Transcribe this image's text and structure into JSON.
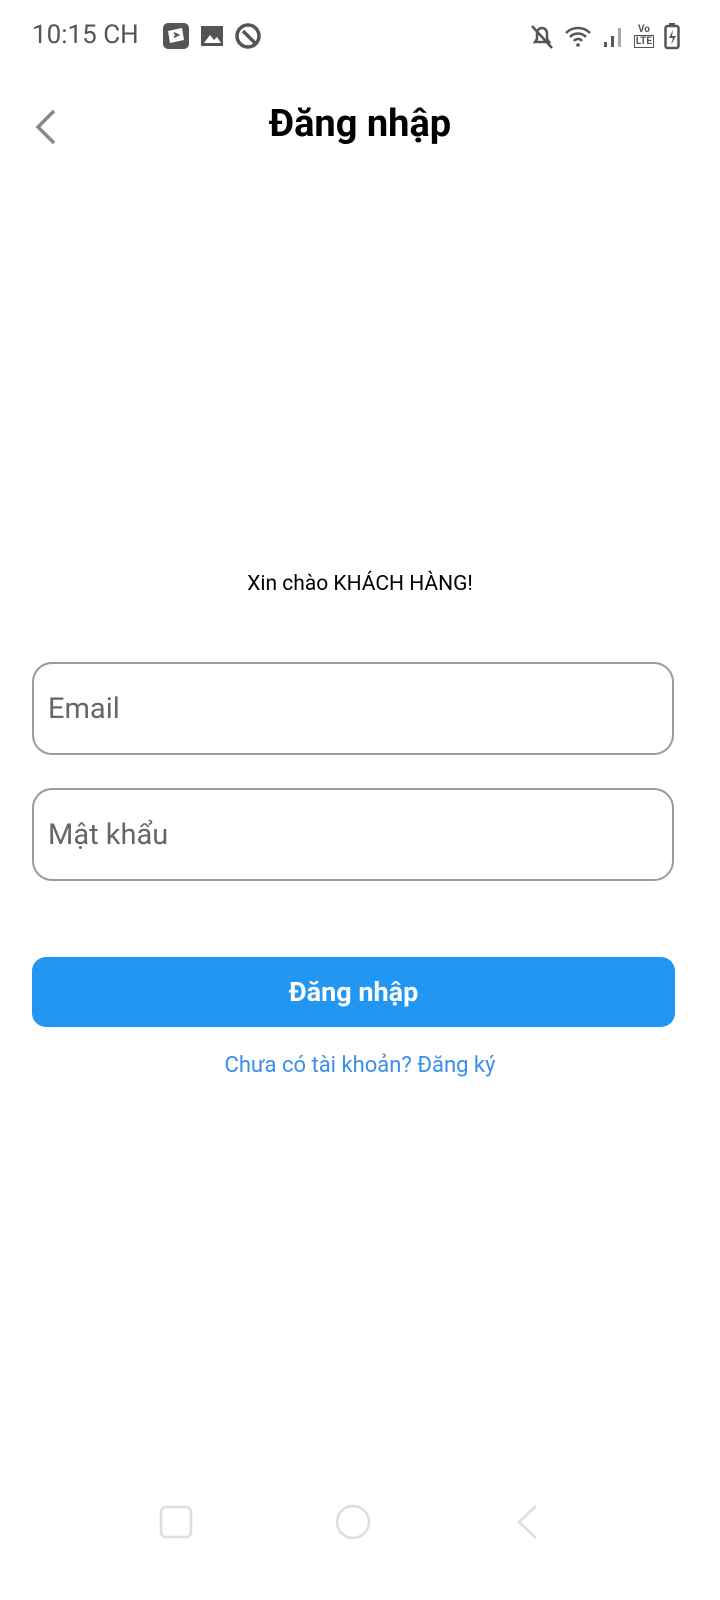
{
  "status_bar": {
    "time": "10:15 CH",
    "left_icons": [
      "video-app-icon",
      "image-icon",
      "app-icon"
    ],
    "right_icons": [
      "bell-off-icon",
      "wifi-icon",
      "signal-icon",
      "volte-icon",
      "battery-charging-icon"
    ],
    "volte_top": "Vo",
    "volte_bottom": "LTE"
  },
  "header": {
    "title": "Đăng nhập",
    "back_icon": "chevron-left-icon"
  },
  "greeting": "Xin chào KHÁCH HÀNG!",
  "form": {
    "email_placeholder": "Email",
    "email_value": "",
    "password_placeholder": "Mật khẩu",
    "password_value": ""
  },
  "login_button": "Đăng nhập",
  "register_link": "Chưa có tài khoản? Đăng ký",
  "colors": {
    "primary": "#2196f3",
    "link": "#3a8ef0"
  },
  "nav_bar": [
    "recents-icon",
    "home-icon",
    "back-icon"
  ]
}
